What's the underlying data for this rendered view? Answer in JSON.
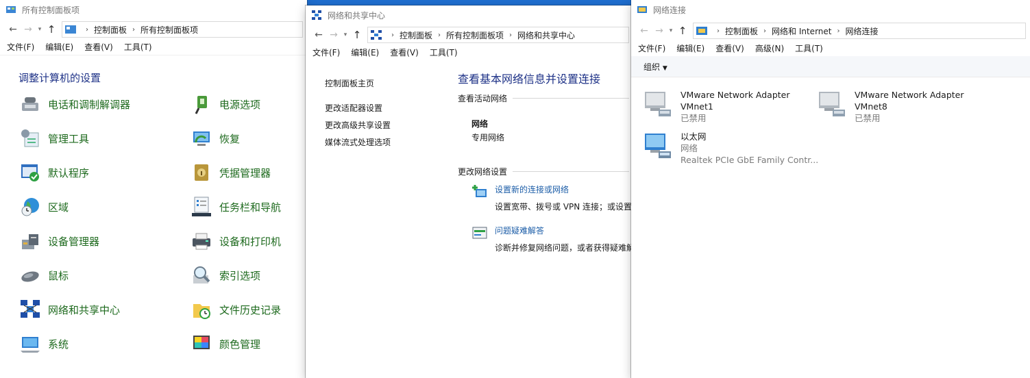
{
  "w1": {
    "title": "所有控制面板项",
    "crumbs": [
      "控制面板",
      "所有控制面板项"
    ],
    "menu": [
      "文件(F)",
      "编辑(E)",
      "查看(V)",
      "工具(T)"
    ],
    "heading": "调整计算机的设置",
    "items": [
      {
        "label": "电话和调制解调器",
        "icon": "phone-modem-icon"
      },
      {
        "label": "电源选项",
        "icon": "power-options-icon"
      },
      {
        "label": "管理工具",
        "icon": "admin-tools-icon"
      },
      {
        "label": "恢复",
        "icon": "recovery-icon"
      },
      {
        "label": "默认程序",
        "icon": "default-programs-icon"
      },
      {
        "label": "凭据管理器",
        "icon": "credential-manager-icon"
      },
      {
        "label": "区域",
        "icon": "region-icon"
      },
      {
        "label": "任务栏和导航",
        "icon": "taskbar-icon"
      },
      {
        "label": "设备管理器",
        "icon": "device-manager-icon"
      },
      {
        "label": "设备和打印机",
        "icon": "printer-icon"
      },
      {
        "label": "鼠标",
        "icon": "mouse-icon"
      },
      {
        "label": "索引选项",
        "icon": "index-options-icon"
      },
      {
        "label": "网络和共享中心",
        "icon": "network-center-icon"
      },
      {
        "label": "文件历史记录",
        "icon": "file-history-icon"
      },
      {
        "label": "系统",
        "icon": "system-icon"
      },
      {
        "label": "颜色管理",
        "icon": "color-management-icon"
      }
    ]
  },
  "w2": {
    "title": "网络和共享中心",
    "crumbs": [
      "控制面板",
      "所有控制面板项",
      "网络和共享中心"
    ],
    "menu": [
      "文件(F)",
      "编辑(E)",
      "查看(V)",
      "工具(T)"
    ],
    "side_links": [
      "控制面板主页",
      "更改适配器设置",
      "更改高级共享设置",
      "媒体流式处理选项"
    ],
    "main_title": "查看基本网络信息并设置连接",
    "active_section": "查看活动网络",
    "network_name": "网络",
    "network_type": "专用网络",
    "change_section": "更改网络设置",
    "tasks": [
      {
        "link": "设置新的连接或网络",
        "desc": "设置宽带、拨号或 VPN 连接；或设置"
      },
      {
        "link": "问题疑难解答",
        "desc": "诊断并修复网络问题，或者获得疑难解"
      }
    ]
  },
  "w3": {
    "title": "网络连接",
    "crumbs": [
      "控制面板",
      "网络和 Internet",
      "网络连接"
    ],
    "menu": [
      "文件(F)",
      "编辑(E)",
      "查看(V)",
      "高级(N)",
      "工具(T)"
    ],
    "organize": "组织",
    "adapters": [
      {
        "name": "VMware Network Adapter",
        "sub": "VMnet1",
        "status": "已禁用"
      },
      {
        "name": "VMware Network Adapter",
        "sub": "VMnet8",
        "status": "已禁用"
      },
      {
        "name": "以太网",
        "sub": "网络",
        "status": "Realtek PCIe GbE Family Contr..."
      }
    ]
  },
  "colors": {
    "link": "#1d5ea8",
    "heading": "#1e3287",
    "cp_green": "#1e6a1e",
    "desktop": "#1f6fd1"
  }
}
